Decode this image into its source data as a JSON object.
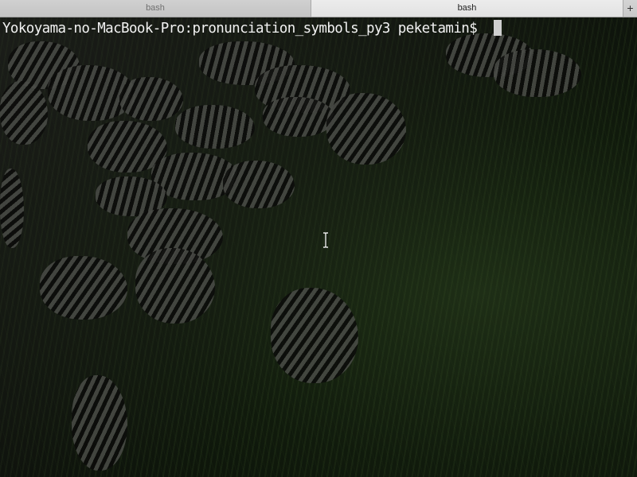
{
  "tabs": [
    {
      "label": "bash",
      "active": false
    },
    {
      "label": "bash",
      "active": true
    }
  ],
  "new_tab_label": "+",
  "terminal": {
    "prompt": "Yokoyama-no-MacBook-Pro:pronunciation_symbols_py3 peketamin$ ",
    "background_description_icon": "zebra-herd-wallpaper"
  },
  "colors": {
    "text": "#f2f2f2",
    "cursor": "#cfcfcf",
    "tab_active": "#e6e6e6",
    "tab_inactive": "#c9c9c9"
  }
}
